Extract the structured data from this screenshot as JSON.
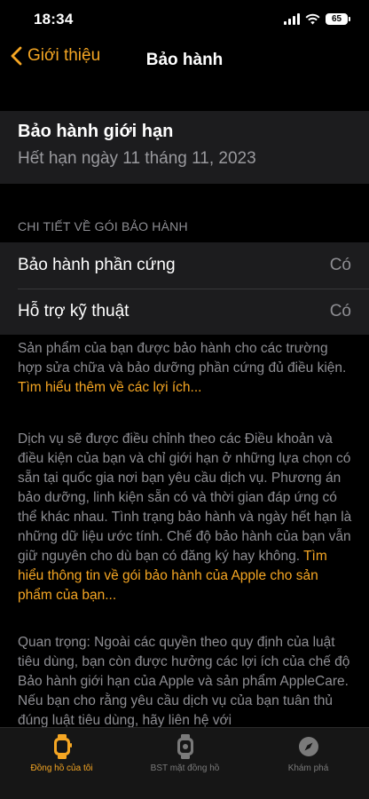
{
  "status": {
    "time": "18:34",
    "battery": "65"
  },
  "nav": {
    "back_label": "Giới thiệu",
    "title": "Bảo hành"
  },
  "summary": {
    "title": "Bảo hành giới hạn",
    "subtitle": "Hết hạn ngày 11 tháng 11, 2023"
  },
  "details": {
    "header": "CHI TIẾT VỀ GÓI BẢO HÀNH",
    "rows": [
      {
        "label": "Bảo hành phần cứng",
        "value": "Có"
      },
      {
        "label": "Hỗ trợ kỹ thuật",
        "value": "Có"
      }
    ]
  },
  "info": {
    "p1_text": "Sản phẩm của bạn được bảo hành cho các trường hợp sửa chữa và bảo dưỡng phần cứng đủ điều kiện. ",
    "p1_link": "Tìm hiểu thêm về các lợi ích...",
    "p2_text": "Dịch vụ sẽ được điều chỉnh theo các Điều khoản và điều kiện của bạn và chỉ giới hạn ở những lựa chọn có sẵn tại quốc gia nơi bạn yêu cầu dịch vụ. Phương án bảo dưỡng, linh kiện sẵn có và thời gian đáp ứng có thể khác nhau. Tình trạng bảo hành và ngày hết hạn là những dữ liệu ước tính. Chế độ bảo hành của bạn vẫn giữ nguyên cho dù bạn có đăng ký hay không. ",
    "p2_link": "Tìm hiểu thông tin về gói bảo hành của Apple cho sản phẩm của bạn...",
    "p3_text": "Quan trọng: Ngoài các quyền theo quy định của luật tiêu dùng, bạn còn được hưởng các lợi ích của chế độ Bảo hành giới hạn của Apple và sản phẩm AppleCare. Nếu bạn cho rằng yêu cầu dịch vụ của bạn tuân thủ đúng luật tiêu dùng, hãy liên hệ với"
  },
  "tabs": [
    {
      "label": "Đồng hồ của tôi",
      "icon": "watch-icon",
      "active": true
    },
    {
      "label": "BST mặt đồng hồ",
      "icon": "watch-face-icon",
      "active": false
    },
    {
      "label": "Khám phá",
      "icon": "compass-icon",
      "active": false
    }
  ],
  "colors": {
    "accent": "#f5a623",
    "background": "#000000",
    "cell": "#1c1c1e",
    "secondary_text": "#8e8e93"
  }
}
